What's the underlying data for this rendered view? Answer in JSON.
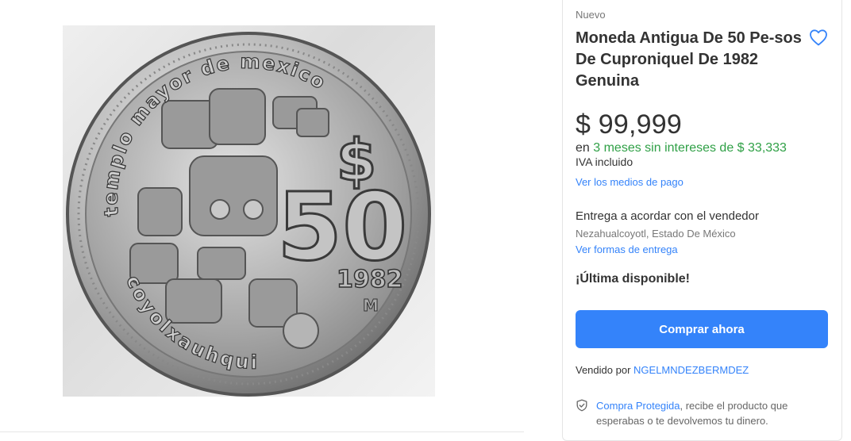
{
  "product": {
    "condition": "Nuevo",
    "title": "Moneda Antigua De 50 Pe-sos De Cuproniquel De 1982 Genuina",
    "price": "$ 99,999",
    "installments_prefix": "en",
    "installments_highlight": "3 meses sin intereses de $ 33,333",
    "tax_note": "IVA incluido",
    "payment_link": "Ver los medios de pago"
  },
  "image": {
    "legend_top": "templo mayor de mexico",
    "legend_bottom": "coyolxauhqui",
    "denomination_symbol": "$",
    "denomination_value": "50",
    "year": "1982",
    "mint_mark": "M"
  },
  "shipping": {
    "title": "Entrega a acordar con el vendedor",
    "location": "Nezahualcoyotl, Estado De México",
    "link": "Ver formas de entrega"
  },
  "stock": {
    "label": "¡Última disponible!"
  },
  "actions": {
    "buy_label": "Comprar ahora"
  },
  "seller": {
    "prefix": "Vendido por",
    "name": "NGELMNDEZBERMDEZ"
  },
  "protection": {
    "link": "Compra Protegida",
    "text": ", recibe el producto que esperabas o te devolvemos tu dinero."
  },
  "colors": {
    "accent": "#3483fa",
    "green": "#2fa046"
  },
  "icons": {
    "favorite": "heart-outline-icon",
    "protection": "shield-check-icon"
  }
}
